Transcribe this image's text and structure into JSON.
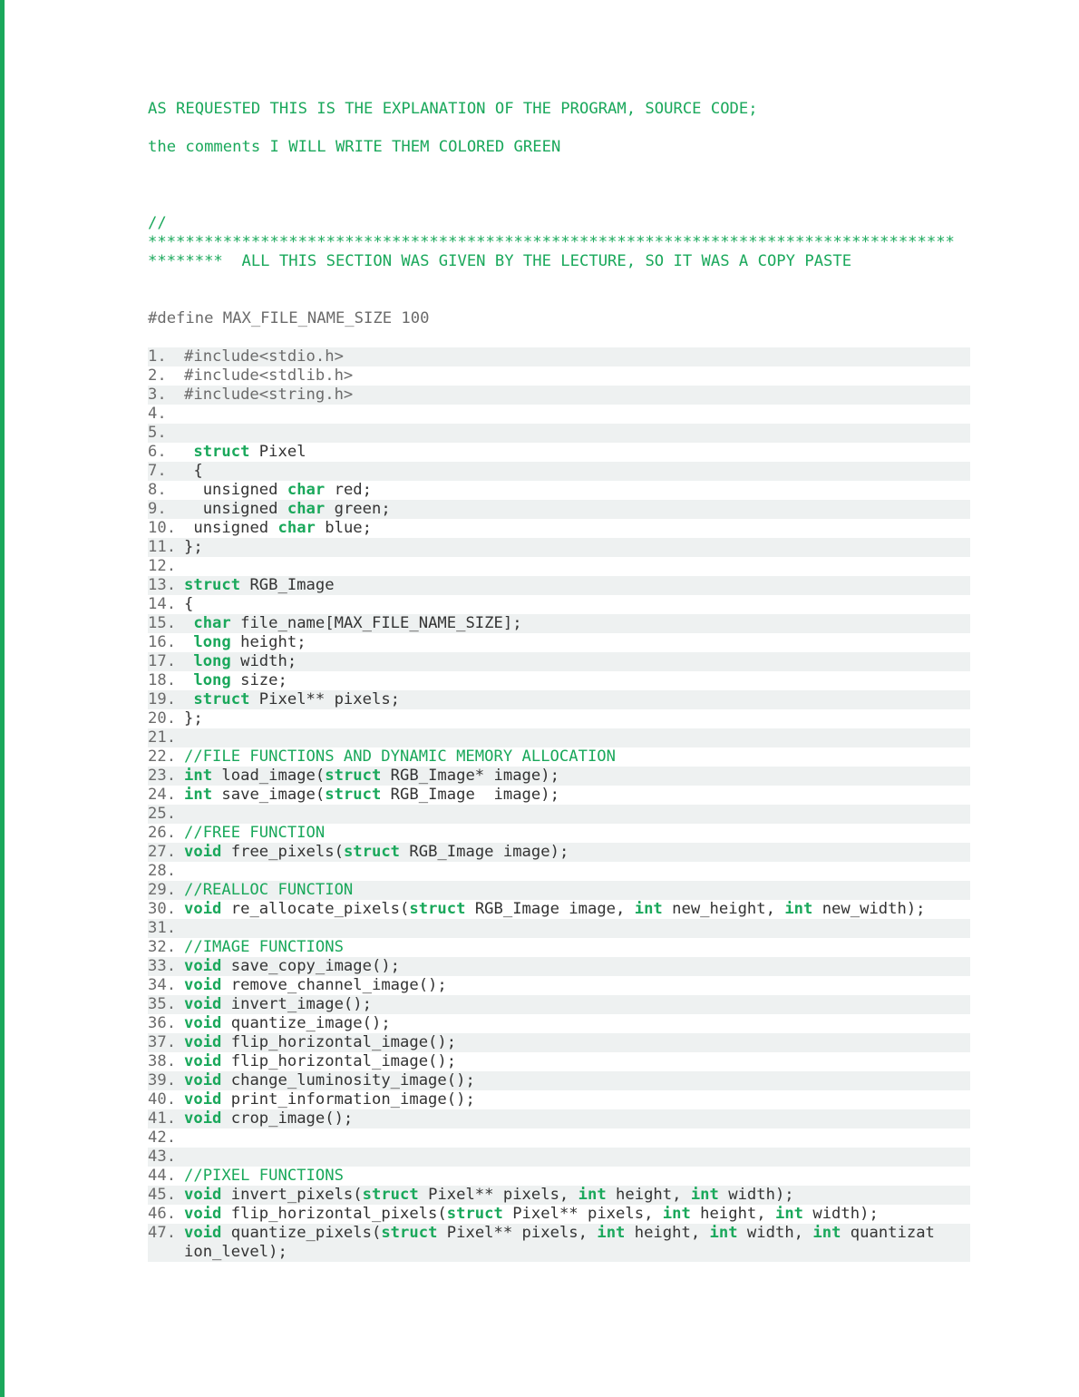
{
  "intro": {
    "line1": "AS REQUESTED THIS IS THE EXPLANATION OF THE PROGRAM, SOURCE CODE;",
    "line2": "the comments I WILL WRITE THEM COLORED GREEN"
  },
  "separator": {
    "slashes": "//",
    "stars1": "**************************************************************************************",
    "stars2_prefix": "********  ",
    "stars2_text": "ALL THIS SECTION WAS GIVEN BY THE LECTURE, SO IT WAS A COPY PASTE"
  },
  "define_line": "#define MAX_FILE_NAME_SIZE 100",
  "lines": {
    "1": {
      "n": "1. ",
      "type": "inc",
      "text": "#include<stdio.h>"
    },
    "2": {
      "n": "2. ",
      "type": "inc",
      "text": "#include<stdlib.h>"
    },
    "3": {
      "n": "3. ",
      "type": "inc",
      "text": "#include<string.h>"
    },
    "4": {
      "n": "4. ",
      "type": "blank",
      "text": ""
    },
    "5": {
      "n": "5. ",
      "type": "blank",
      "text": ""
    },
    "6": {
      "n": "6. ",
      "type": "code",
      "pre": " ",
      "kw": "struct",
      "post": " Pixel"
    },
    "7": {
      "n": "7. ",
      "type": "plain",
      "text": " {"
    },
    "8": {
      "n": "8. ",
      "type": "code",
      "pre": "  unsigned ",
      "kw": "char",
      "post": " red;"
    },
    "9": {
      "n": "9. ",
      "type": "code",
      "pre": "  unsigned ",
      "kw": "char",
      "post": " green;"
    },
    "10": {
      "n": "10.",
      "type": "code",
      "pre": " unsigned ",
      "kw": "char",
      "post": " blue;"
    },
    "11": {
      "n": "11.",
      "type": "plain",
      "text": "};"
    },
    "12": {
      "n": "12.",
      "type": "blank",
      "text": ""
    },
    "13": {
      "n": "13.",
      "type": "code",
      "pre": "",
      "kw": "struct",
      "post": " RGB_Image"
    },
    "14": {
      "n": "14.",
      "type": "plain",
      "text": "{"
    },
    "15": {
      "n": "15.",
      "type": "code",
      "pre": " ",
      "kw": "char",
      "post": " file_name[MAX_FILE_NAME_SIZE];"
    },
    "16": {
      "n": "16.",
      "type": "code",
      "pre": " ",
      "kw": "long",
      "post": " height;"
    },
    "17": {
      "n": "17.",
      "type": "code",
      "pre": " ",
      "kw": "long",
      "post": " width;"
    },
    "18": {
      "n": "18.",
      "type": "code",
      "pre": " ",
      "kw": "long",
      "post": " size;"
    },
    "19": {
      "n": "19.",
      "type": "code",
      "pre": " ",
      "kw": "struct",
      "post": " Pixel** pixels;"
    },
    "20": {
      "n": "20.",
      "type": "plain",
      "text": "};"
    },
    "21": {
      "n": "21.",
      "type": "blank",
      "text": ""
    },
    "22": {
      "n": "22.",
      "type": "cmt",
      "text": "//FILE FUNCTIONS AND DYNAMIC MEMORY ALLOCATION"
    },
    "23": {
      "n": "23.",
      "type": "multi",
      "segs": [
        {
          "kw": "int"
        },
        {
          "t": " load_image("
        },
        {
          "kw": "struct"
        },
        {
          "t": " RGB_Image* image);"
        }
      ]
    },
    "24": {
      "n": "24.",
      "type": "multi",
      "segs": [
        {
          "kw": "int"
        },
        {
          "t": " save_image("
        },
        {
          "kw": "struct"
        },
        {
          "t": " RGB_Image  image);"
        }
      ]
    },
    "25": {
      "n": "25.",
      "type": "blank",
      "text": ""
    },
    "26": {
      "n": "26.",
      "type": "cmt",
      "text": "//FREE FUNCTION"
    },
    "27": {
      "n": "27.",
      "type": "multi",
      "segs": [
        {
          "kw": "void"
        },
        {
          "t": " free_pixels("
        },
        {
          "kw": "struct"
        },
        {
          "t": " RGB_Image image);"
        }
      ]
    },
    "28": {
      "n": "28.",
      "type": "blank",
      "text": ""
    },
    "29": {
      "n": "29.",
      "type": "cmt",
      "text": "//REALLOC FUNCTION"
    },
    "30": {
      "n": "30.",
      "type": "multi",
      "segs": [
        {
          "kw": "void"
        },
        {
          "t": " re_allocate_pixels("
        },
        {
          "kw": "struct"
        },
        {
          "t": " RGB_Image image, "
        },
        {
          "kw": "int"
        },
        {
          "t": " new_height, "
        },
        {
          "kw": "int"
        },
        {
          "t": " new_width);"
        }
      ]
    },
    "31": {
      "n": "31.",
      "type": "blank",
      "text": ""
    },
    "32": {
      "n": "32.",
      "type": "cmt",
      "text": "//IMAGE FUNCTIONS"
    },
    "33": {
      "n": "33.",
      "type": "code",
      "pre": "",
      "kw": "void",
      "post": " save_copy_image();"
    },
    "34": {
      "n": "34.",
      "type": "code",
      "pre": "",
      "kw": "void",
      "post": " remove_channel_image();"
    },
    "35": {
      "n": "35.",
      "type": "code",
      "pre": "",
      "kw": "void",
      "post": " invert_image();"
    },
    "36": {
      "n": "36.",
      "type": "code",
      "pre": "",
      "kw": "void",
      "post": " quantize_image();"
    },
    "37": {
      "n": "37.",
      "type": "code",
      "pre": "",
      "kw": "void",
      "post": " flip_horizontal_image();"
    },
    "38": {
      "n": "38.",
      "type": "code",
      "pre": "",
      "kw": "void",
      "post": " flip_horizontal_image();"
    },
    "39": {
      "n": "39.",
      "type": "code",
      "pre": "",
      "kw": "void",
      "post": " change_luminosity_image();"
    },
    "40": {
      "n": "40.",
      "type": "code",
      "pre": "",
      "kw": "void",
      "post": " print_information_image();"
    },
    "41": {
      "n": "41.",
      "type": "code",
      "pre": "",
      "kw": "void",
      "post": " crop_image();"
    },
    "42": {
      "n": "42.",
      "type": "blank",
      "text": ""
    },
    "43": {
      "n": "43.",
      "type": "blank",
      "text": ""
    },
    "44": {
      "n": "44.",
      "type": "cmt",
      "text": "//PIXEL FUNCTIONS"
    },
    "45": {
      "n": "45.",
      "type": "multi",
      "segs": [
        {
          "kw": "void"
        },
        {
          "t": " invert_pixels("
        },
        {
          "kw": "struct"
        },
        {
          "t": " Pixel** pixels, "
        },
        {
          "kw": "int"
        },
        {
          "t": " height, "
        },
        {
          "kw": "int"
        },
        {
          "t": " width);"
        }
      ]
    },
    "46": {
      "n": "46.",
      "type": "multi",
      "segs": [
        {
          "kw": "void"
        },
        {
          "t": " flip_horizontal_pixels("
        },
        {
          "kw": "struct"
        },
        {
          "t": " Pixel** pixels, "
        },
        {
          "kw": "int"
        },
        {
          "t": " height, "
        },
        {
          "kw": "int"
        },
        {
          "t": " width);"
        }
      ]
    },
    "47": {
      "n": "47.",
      "type": "multi",
      "segs": [
        {
          "kw": "void"
        },
        {
          "t": " quantize_pixels("
        },
        {
          "kw": "struct"
        },
        {
          "t": " Pixel** pixels, "
        },
        {
          "kw": "int"
        },
        {
          "t": " height, "
        },
        {
          "kw": "int"
        },
        {
          "t": " width, "
        },
        {
          "kw": "int"
        },
        {
          "t": " quantizat"
        }
      ]
    },
    "47b": {
      "text": "ion_level);"
    }
  },
  "stripes": [
    1,
    3,
    5,
    7,
    9,
    11,
    13,
    15,
    17,
    19,
    21,
    23,
    25,
    27,
    29,
    31,
    33,
    35,
    37,
    39,
    41,
    43,
    45,
    47
  ]
}
